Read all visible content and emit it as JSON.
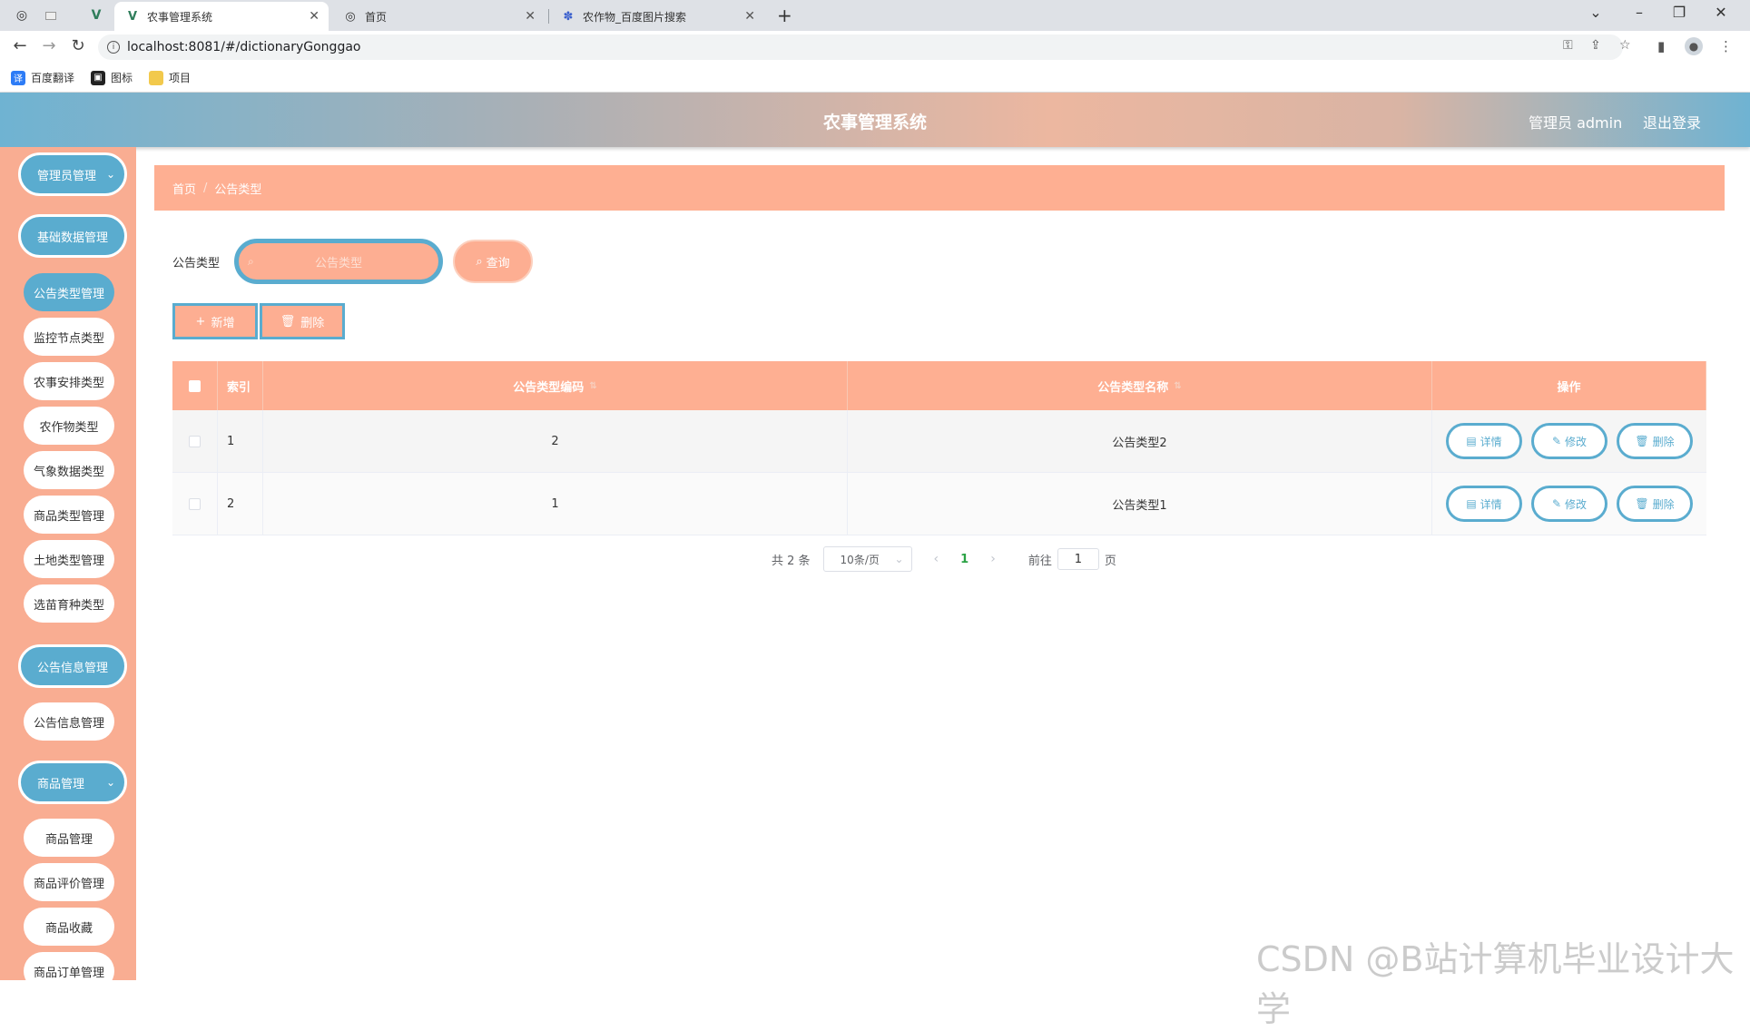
{
  "browser": {
    "tabs": [
      {
        "title": "农事管理系统",
        "active": true
      },
      {
        "title": "首页",
        "active": false
      },
      {
        "title": "农作物_百度图片搜索",
        "active": false
      }
    ],
    "url": "localhost:8081/#/dictionaryGonggao",
    "bookmarks": [
      "百度翻译",
      "图标",
      "项目"
    ]
  },
  "header": {
    "title": "农事管理系统",
    "user": "管理员 admin",
    "logout": "退出登录"
  },
  "sidebar": {
    "groups": [
      {
        "label": "管理员管理"
      },
      {
        "label": "基础数据管理"
      },
      {
        "label": "公告信息管理"
      },
      {
        "label": "商品管理"
      }
    ],
    "items": [
      {
        "label": "公告类型管理"
      },
      {
        "label": "监控节点类型"
      },
      {
        "label": "农事安排类型"
      },
      {
        "label": "农作物类型"
      },
      {
        "label": "气象数据类型"
      },
      {
        "label": "商品类型管理"
      },
      {
        "label": "土地类型管理"
      },
      {
        "label": "选苗育种类型"
      },
      {
        "label": "公告信息管理"
      },
      {
        "label": "商品管理"
      },
      {
        "label": "商品评价管理"
      },
      {
        "label": "商品收藏"
      },
      {
        "label": "商品订单管理"
      }
    ]
  },
  "breadcrumb": {
    "home": "首页",
    "current": "公告类型"
  },
  "search": {
    "label": "公告类型",
    "placeholder": "公告类型",
    "button": "查询"
  },
  "actions": {
    "add": "新增",
    "delete": "删除"
  },
  "table": {
    "headers": {
      "index": "索引",
      "code": "公告类型编码",
      "name": "公告类型名称",
      "ops": "操作"
    },
    "rows": [
      {
        "index": "1",
        "code": "2",
        "name": "公告类型2"
      },
      {
        "index": "2",
        "code": "1",
        "name": "公告类型1"
      }
    ],
    "ops": {
      "detail": "详情",
      "edit": "修改",
      "delete": "删除"
    }
  },
  "pagination": {
    "total": "共 2 条",
    "page_size": "10条/页",
    "current_page": "1",
    "goto_label": "前往",
    "goto_value": "1",
    "page_unit": "页"
  },
  "watermark": "CSDN @B站计算机毕业设计大学",
  "colors": {
    "accent_blue": "#5aaccf",
    "accent_peach": "#feaf92",
    "page_current": "#2ba245"
  }
}
